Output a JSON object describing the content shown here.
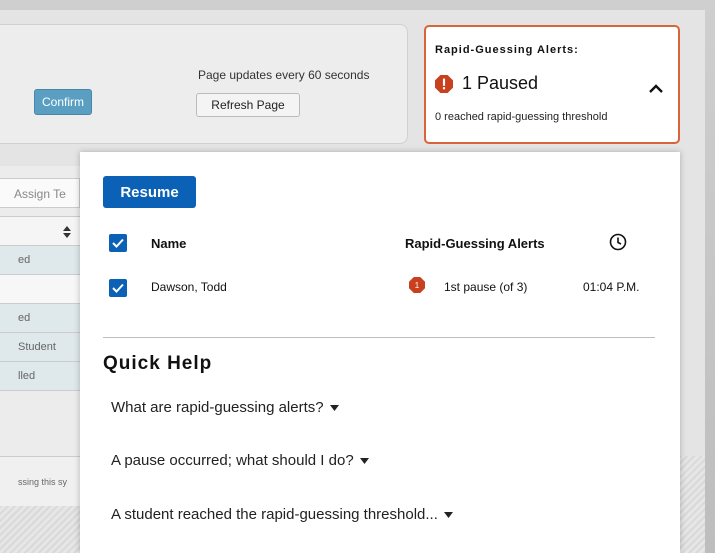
{
  "topbar": {
    "confirm_label": "Confirm",
    "update_note": "Page updates every 60 seconds",
    "refresh_label": "Refresh Page"
  },
  "alerts_card": {
    "title": "Rapid-Guessing Alerts:",
    "count_text": "1 Paused",
    "subtext": "0 reached rapid-guessing threshold",
    "icon": "stop-alert-icon",
    "border_color": "#d9643a",
    "icon_color": "#c9401f"
  },
  "background_table": {
    "assign_placeholder": "Assign Te",
    "rows": [
      "ed",
      "",
      "ed",
      "Student",
      "lled"
    ]
  },
  "footer": {
    "text": "ssing this sy"
  },
  "popover": {
    "resume_label": "Resume",
    "columns": {
      "name": "Name",
      "alerts": "Rapid-Guessing Alerts",
      "time_icon": "clock-icon"
    },
    "rows": [
      {
        "name": "Dawson, Todd",
        "badge": "1",
        "alert": "1st pause (of 3)",
        "time": "01:04 P.M.",
        "checked": true
      }
    ],
    "quick_help": {
      "title": "Quick Help",
      "links": [
        "What are rapid-guessing alerts?",
        "A pause occurred; what should I do?",
        "A student reached the rapid-guessing threshold..."
      ]
    }
  },
  "colors": {
    "primary": "#0a61b5",
    "confirm": "#5a9fc2",
    "alert": "#c9401f"
  }
}
